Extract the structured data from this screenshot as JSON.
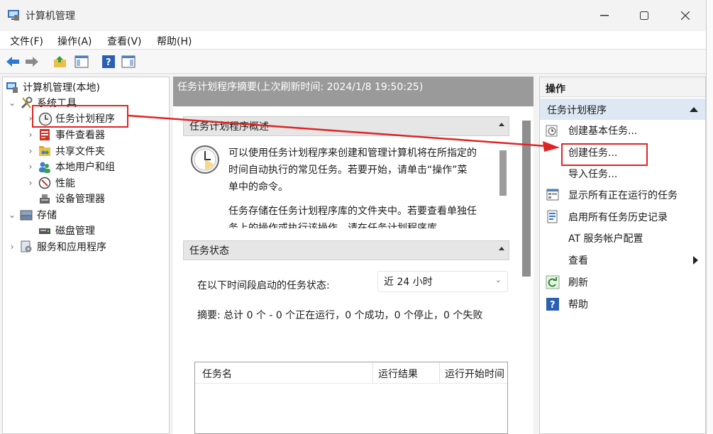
{
  "window": {
    "title": "计算机管理"
  },
  "menu": [
    {
      "label": "文件(F)"
    },
    {
      "label": "操作(A)"
    },
    {
      "label": "查看(V)"
    },
    {
      "label": "帮助(H)"
    }
  ],
  "tree": {
    "root": "计算机管理(本地)",
    "system_tools": "系统工具",
    "task_scheduler": "任务计划程序",
    "event_viewer": "事件查看器",
    "shared_folders": "共享文件夹",
    "local_users": "本地用户和组",
    "performance": "性能",
    "device_manager": "设备管理器",
    "storage": "存储",
    "disk_mgmt": "磁盘管理",
    "services_apps": "服务和应用程序"
  },
  "center": {
    "summary_header": "任务计划程序摘要(上次刷新时间: 2024/1/8 19:50:25)",
    "overview": {
      "title": "任务计划程序概述",
      "para1": "可以使用任务计划程序来创建和管理计算机将在所指定的时间自动执行的常见任务。若要开始，请单击“操作”菜单中的命令。",
      "para2": "任务存储在任务计划程序库的文件夹中。若要查看单独任务上的操作或执行该操作，请在任务计划程序库"
    },
    "status": {
      "title": "任务状态",
      "label": "在以下时间段启动的任务状态:",
      "select_value": "近 24 小时",
      "summary": "摘要: 总计 0 个 - 0 个正在运行，0 个成功，0 个停止，0 个失败",
      "columns": [
        "任务名",
        "运行结果",
        "运行开始时间"
      ]
    }
  },
  "actions": {
    "header": "操作",
    "section": "任务计划程序",
    "items": [
      {
        "label": "创建基本任务..."
      },
      {
        "label": "创建任务..."
      },
      {
        "label": "导入任务..."
      },
      {
        "label": "显示所有正在运行的任务"
      },
      {
        "label": "启用所有任务历史记录"
      },
      {
        "label": "AT 服务帐户配置"
      },
      {
        "label": "查看"
      },
      {
        "label": "刷新"
      },
      {
        "label": "帮助"
      }
    ]
  },
  "colors": {
    "highlight": "#e02424",
    "accent": "#0c64c5"
  }
}
